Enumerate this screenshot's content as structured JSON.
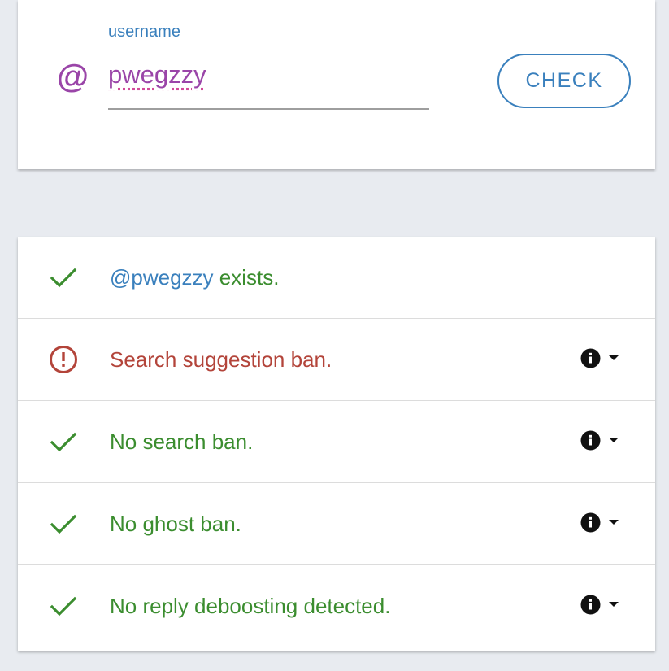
{
  "search": {
    "at_symbol": "@",
    "label": "username",
    "value": "pwegzzy",
    "button_label": "CHECK"
  },
  "results": {
    "exists": {
      "handle": "@pwegzzy",
      "text": " exists.",
      "status": "ok",
      "icon": "check-icon"
    },
    "items": [
      {
        "text": "Search suggestion ban.",
        "status": "bad",
        "icon": "alert-circle-icon"
      },
      {
        "text": "No search ban.",
        "status": "ok",
        "icon": "check-icon"
      },
      {
        "text": "No ghost ban.",
        "status": "ok",
        "icon": "check-icon"
      },
      {
        "text": "No reply deboosting detected.",
        "status": "ok",
        "icon": "check-icon"
      }
    ]
  },
  "colors": {
    "accent_blue": "#3a80bd",
    "brand_purple": "#9a45a8",
    "ok_green": "#3b8d2f",
    "bad_red": "#b3443a",
    "background": "#e8ebf0"
  }
}
